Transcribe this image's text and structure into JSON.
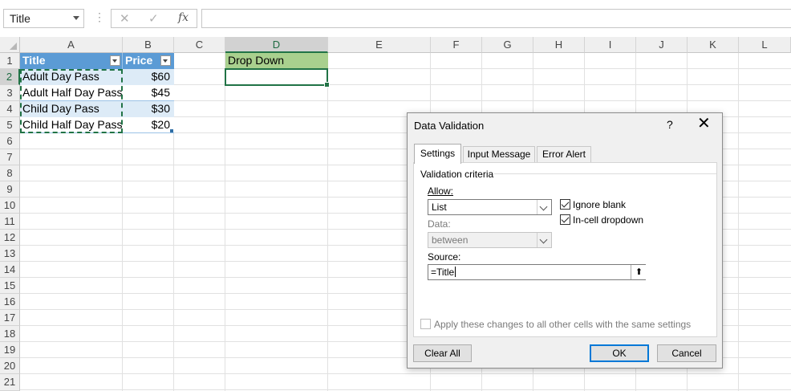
{
  "formula_bar": {
    "name_box": "Title",
    "cancel_glyph": "✕",
    "enter_glyph": "✓",
    "fx_glyph": "fx",
    "formula": ""
  },
  "columns": [
    "A",
    "B",
    "C",
    "D",
    "E",
    "F",
    "G",
    "H",
    "I",
    "J",
    "K",
    "L"
  ],
  "rows": [
    "1",
    "2",
    "3",
    "4",
    "5",
    "6",
    "7",
    "8",
    "9",
    "10",
    "11",
    "12",
    "13",
    "14",
    "15",
    "16",
    "17",
    "18",
    "19",
    "20",
    "21"
  ],
  "selected_column": "D",
  "selected_row": "2",
  "table": {
    "headers": [
      "Title",
      "Price"
    ],
    "rows": [
      [
        "Adult Day Pass",
        "$60"
      ],
      [
        "Adult Half Day Pass",
        "$45"
      ],
      [
        "Child Day Pass",
        "$30"
      ],
      [
        "Child Half Day Pass",
        "$20"
      ]
    ]
  },
  "cell_d1": "Drop Down",
  "colors": {
    "table_header": "#5b9bd5",
    "table_band": "#ddebf7",
    "d1_fill": "#a9d08e",
    "excel_green": "#217346"
  },
  "dialog": {
    "title": "Data Validation",
    "help": "?",
    "close": "✕",
    "tabs": [
      "Settings",
      "Input Message",
      "Error Alert"
    ],
    "validation_criteria": "Validation criteria",
    "allow_label": "Allow:",
    "allow_value": "List",
    "ignore_blank": "Ignore blank",
    "in_cell_dropdown": "In-cell dropdown",
    "data_label": "Data:",
    "data_value": "between",
    "source_label": "Source:",
    "source_value": "=Title",
    "source_btn_glyph": "⬆",
    "apply_text": "Apply these changes to all other cells with the same settings",
    "clear_all": "Clear All",
    "ok": "OK",
    "cancel": "Cancel"
  }
}
